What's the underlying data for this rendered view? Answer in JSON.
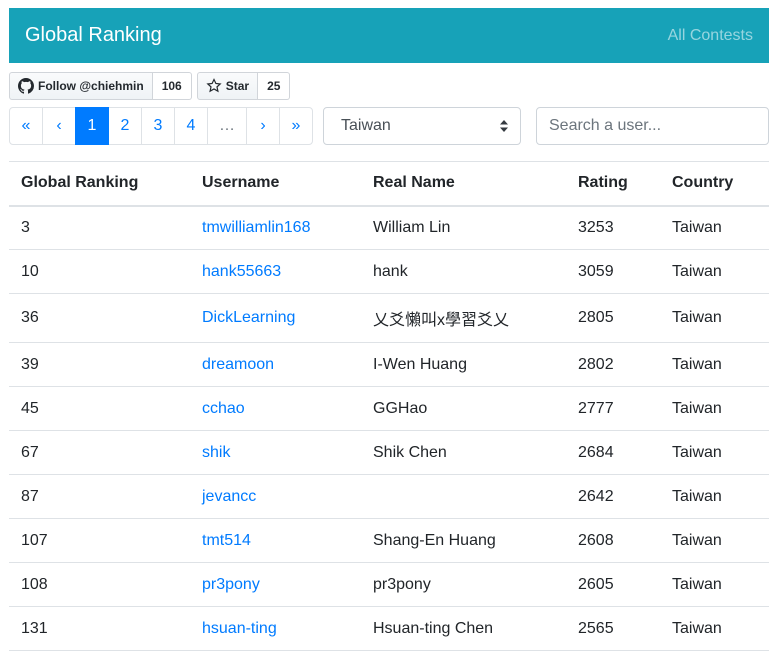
{
  "navbar": {
    "brand": "Global Ranking",
    "link": "All Contests",
    "color": "#17a2b8"
  },
  "github": {
    "follow": {
      "icon": "github-icon",
      "label": "Follow @chiehmin",
      "count": "106"
    },
    "star": {
      "icon": "star-icon",
      "label": "Star",
      "count": "25"
    }
  },
  "pagination": {
    "first": "«",
    "prev": "‹",
    "pages": [
      "1",
      "2",
      "3",
      "4"
    ],
    "ellipsis": "…",
    "next": "›",
    "last": "»",
    "active_page": "1"
  },
  "country_select": {
    "value": "Taiwan",
    "icon": "select-arrows-icon"
  },
  "search": {
    "placeholder": "Search a user..."
  },
  "table": {
    "headers": [
      "Global Ranking",
      "Username",
      "Real Name",
      "Rating",
      "Country"
    ],
    "rows": [
      [
        "3",
        "tmwilliamlin168",
        "William Lin",
        "3253",
        "Taiwan"
      ],
      [
        "10",
        "hank55663",
        "hank",
        "3059",
        "Taiwan"
      ],
      [
        "36",
        "DickLearning",
        "乂爻懶叫x學習爻乂",
        "2805",
        "Taiwan"
      ],
      [
        "39",
        "dreamoon",
        "I-Wen Huang",
        "2802",
        "Taiwan"
      ],
      [
        "45",
        "cchao",
        "GGHao",
        "2777",
        "Taiwan"
      ],
      [
        "67",
        "shik",
        "Shik Chen",
        "2684",
        "Taiwan"
      ],
      [
        "87",
        "jevancc",
        "",
        "2642",
        "Taiwan"
      ],
      [
        "107",
        "tmt514",
        "Shang-En Huang",
        "2608",
        "Taiwan"
      ],
      [
        "108",
        "pr3pony",
        "pr3pony",
        "2605",
        "Taiwan"
      ],
      [
        "131",
        "hsuan-ting",
        "Hsuan-ting Chen",
        "2565",
        "Taiwan"
      ]
    ]
  }
}
